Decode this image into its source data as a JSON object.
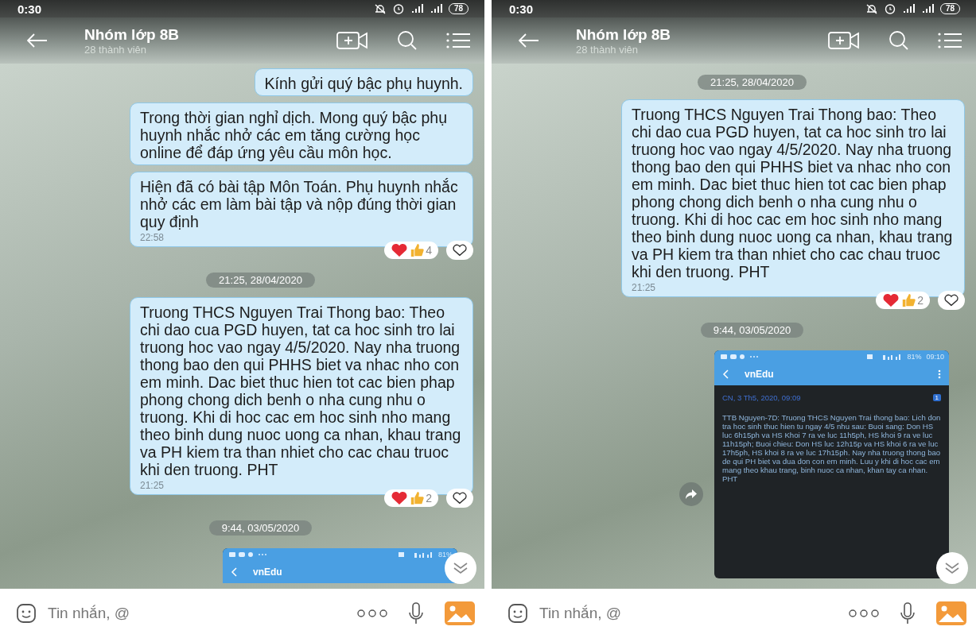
{
  "phones": [
    {
      "status_bar": {
        "time": "0:30",
        "battery": "78"
      },
      "header": {
        "title": "Nhóm lớp 8B",
        "subtitle": "28 thành viên"
      },
      "messages": [
        {
          "kind": "text",
          "text": "Kính gửi quý bậc phụ huynh."
        },
        {
          "kind": "text",
          "text": "Trong thời gian nghỉ dịch. Mong quý bậc phụ huynh nhắc nhở các em tăng cường học online để đáp ứng yêu cầu môn học."
        },
        {
          "kind": "text",
          "text": "Hiện đã có bài tập Môn Toán. Phụ huynh nhắc nhở các em làm bài tập và nộp đúng thời gian quy định",
          "time": "22:58",
          "reaction_count": "4"
        },
        {
          "kind": "date",
          "text": "21:25, 28/04/2020"
        },
        {
          "kind": "text",
          "text": "Truong THCS Nguyen Trai Thong bao: Theo chi dao cua PGD huyen, tat ca hoc sinh tro lai truong hoc vao ngay 4/5/2020. Nay nha truong thong bao den qui PHHS biet va nhac nho con em minh. Dac biet thuc hien tot cac bien phap phong chong dich benh o nha cung nhu o truong. Khi di hoc cac em hoc sinh nho mang theo binh dung nuoc uong ca nhan, khau trang va PH kiem tra than nhiet cho cac chau truoc khi den truong. PHT",
          "time": "21:25",
          "reaction_count": "2"
        },
        {
          "kind": "date",
          "text": "9:44, 03/05/2020"
        },
        {
          "kind": "screenshot",
          "battery": "81%",
          "app_title": "vnEdu"
        }
      ],
      "composer": {
        "placeholder": "Tin nhắn, @"
      }
    },
    {
      "status_bar": {
        "time": "0:30",
        "battery": "78"
      },
      "header": {
        "title": "Nhóm lớp 8B",
        "subtitle": "28 thành viên"
      },
      "messages": [
        {
          "kind": "date",
          "text": "21:25, 28/04/2020"
        },
        {
          "kind": "text",
          "text": "Truong THCS Nguyen Trai Thong bao: Theo chi dao cua PGD huyen, tat ca hoc sinh tro lai truong hoc vao ngay 4/5/2020. Nay nha truong thong bao den qui PHHS biet va nhac nho con em minh. Dac biet thuc hien tot cac bien phap phong chong dich benh o nha cung nhu o truong. Khi di hoc cac em hoc sinh nho mang theo binh dung nuoc uong ca nhan, khau trang va PH kiem tra than nhiet cho cac chau truoc khi den truong. PHT",
          "time": "21:25",
          "reaction_count": "2"
        },
        {
          "kind": "date",
          "text": "9:44, 03/05/2020"
        },
        {
          "kind": "screenshot",
          "battery": "81%",
          "clock": "09:10",
          "app_title": "vnEdu",
          "date": "CN, 3 Th5, 2020, 09:09",
          "badge": "1",
          "forward": true,
          "body": "TTB Nguyen-7D: Truong THCS Nguyen Trai thong bao: Lich don tra hoc sinh thuc hien tu ngay 4/5 nhu sau: Buoi sang: Don HS luc 6h15ph va HS Khoi 7 ra ve luc 11h5ph, HS khoi 9 ra ve luc 11h15ph; Buoi chieu: Don HS luc 12h15p va HS khoi 6 ra ve luc 17h5ph, HS khoi 8 ra ve luc 17h15ph. Nay nha truong thong bao de qui PH biet va dua don con em minh. Luu y khi di hoc cac em mang theo khau trang, binh nuoc ca nhan, khan tay ca nhan. PHT"
        }
      ],
      "composer": {
        "placeholder": "Tin nhắn, @"
      }
    }
  ]
}
